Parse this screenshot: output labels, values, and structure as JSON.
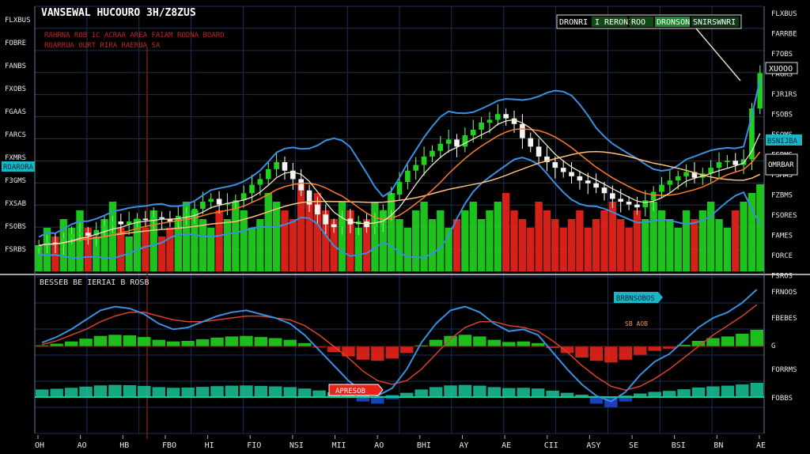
{
  "header": {
    "title": "VANSEWAL HUCOURO 3H/Z8ZUS",
    "subtitle_line1": "RAHRNA ROB 1C ACRAA AREA FAIAM RODNA BOARO",
    "subtitle_line2": "ROARRUA OURT RIRA RAERUA SA"
  },
  "legend_box": {
    "items": [
      "DRONRI",
      "I RERONI",
      "ROO",
      "DRONSON",
      "SNIRSWNRI"
    ]
  },
  "right_tags": {
    "price_tag": "XUOOO",
    "cyan_tag": "BSNIJBA",
    "white_tag": "OMRBAR"
  },
  "left_tag": "ROARORA",
  "y_ticks_main": [
    "FLXBUS",
    "FARRBE",
    "F7OBS",
    "FAGRS",
    "FJR1RS",
    "FSOBS",
    "FSOMS",
    "FSRMS",
    "FSMAS",
    "FZBMS",
    "FSORES",
    "FAMES",
    "FORCE",
    "FSROS"
  ],
  "y_ticks_left": [
    "FLXBUS",
    "FOBRE",
    "FANBS",
    "FXOBS",
    "FGAAS",
    "FARCS",
    "FXMRS",
    "F3GMS",
    "FXSAB",
    "FSOBS",
    "FSRBS"
  ],
  "osc_header": "BESSEB BE IERIAI B ROSB",
  "osc_tags": {
    "cyan": "BRBNSOBOS",
    "red": "APRESOB",
    "small": "SB AOB"
  },
  "y_ticks_osc": [
    "FRNOOS",
    "FBEBES",
    "G",
    "FORRMS",
    "FOBBS"
  ],
  "x_ticks": [
    "OH",
    "AO",
    "HB",
    "FBO",
    "HI",
    "FIO",
    "NSI",
    "MII",
    "AO",
    "BHI",
    "AY",
    "AE",
    "CII",
    "ASY",
    "SE",
    "BSI",
    "BN",
    "AE"
  ],
  "colors": {
    "up": "#1fd21f",
    "down": "#e8241a",
    "band": "#3a8fe0",
    "ma_fast": "#f0e6c8",
    "ma_slow": "#ff7a2a",
    "ma_mid": "#ffbf7a",
    "grid": "#1c2f5a",
    "teal": "#17c79a"
  },
  "chart_data": {
    "type": "line",
    "title": "VANSEWAL HUCOURO 3H/Z8ZUS",
    "price": {
      "close": [
        6.1,
        6.3,
        6.2,
        6.6,
        6.9,
        7.0,
        6.8,
        7.2,
        7.5,
        7.8,
        7.6,
        7.8,
        8.0,
        7.9,
        8.1,
        8.0,
        7.8,
        8.2,
        8.4,
        8.7,
        9.2,
        9.4,
        9.0,
        9.1,
        9.3,
        9.8,
        10.4,
        10.8,
        11.5,
        12.0,
        11.4,
        10.8,
        10.0,
        9.0,
        8.3,
        7.6,
        7.4,
        8.0,
        7.6,
        7.8,
        7.4,
        7.7,
        8.6,
        9.7,
        10.6,
        11.4,
        11.8,
        12.4,
        12.8,
        13.3,
        13.6,
        13.1,
        13.9,
        14.3,
        14.8,
        15.0,
        15.4,
        15.1,
        14.7,
        13.7,
        13.1,
        12.4,
        12.0,
        11.6,
        11.3,
        11.0,
        10.7,
        10.5,
        10.2,
        9.8,
        9.4,
        9.2,
        9.0,
        8.8,
        9.3,
        9.9,
        10.4,
        10.7,
        11.0,
        11.3,
        10.9,
        11.2,
        11.6,
        12.0,
        12.1,
        11.8,
        12.2,
        15.8,
        18.3
      ],
      "ylim": [
        5,
        19
      ]
    },
    "volume": {
      "values": [
        3,
        5,
        4,
        6,
        5,
        7,
        5,
        4,
        6,
        8,
        5,
        4,
        6,
        5,
        7,
        4,
        5,
        6,
        8,
        7,
        6,
        5,
        7,
        6,
        8,
        7,
        5,
        6,
        9,
        8,
        7,
        6,
        10,
        8,
        9,
        7,
        6,
        8,
        7,
        5,
        6,
        8,
        7,
        9,
        6,
        5,
        7,
        8,
        6,
        7,
        5,
        6,
        7,
        8,
        6,
        7,
        8,
        9,
        7,
        6,
        5,
        8,
        7,
        6,
        5,
        6,
        7,
        5,
        6,
        7,
        8,
        6,
        5,
        7,
        6,
        8,
        7,
        6,
        5,
        7,
        6,
        7,
        8,
        6,
        5,
        7,
        8,
        9,
        10
      ],
      "up": [
        1,
        1,
        0,
        1,
        1,
        1,
        0,
        1,
        1,
        1,
        0,
        1,
        1,
        0,
        1,
        0,
        0,
        1,
        1,
        1,
        1,
        1,
        0,
        1,
        1,
        1,
        1,
        1,
        1,
        1,
        0,
        0,
        0,
        0,
        0,
        0,
        0,
        1,
        0,
        1,
        0,
        1,
        1,
        1,
        1,
        1,
        1,
        1,
        1,
        1,
        1,
        0,
        1,
        1,
        1,
        1,
        1,
        0,
        0,
        0,
        0,
        0,
        0,
        0,
        0,
        0,
        0,
        0,
        0,
        0,
        0,
        0,
        0,
        0,
        1,
        1,
        1,
        1,
        1,
        1,
        0,
        1,
        1,
        1,
        1,
        0,
        1,
        1,
        1
      ]
    },
    "oscillator": {
      "macd": [
        0.2,
        0.5,
        0.9,
        1.4,
        1.9,
        2.1,
        2.0,
        1.7,
        1.2,
        0.9,
        1.0,
        1.3,
        1.6,
        1.8,
        1.9,
        1.7,
        1.5,
        1.2,
        0.6,
        -0.2,
        -1.0,
        -1.8,
        -2.4,
        -2.6,
        -2.2,
        -1.2,
        0.2,
        1.2,
        1.9,
        2.1,
        1.8,
        1.2,
        0.8,
        0.9,
        0.6,
        -0.3,
        -1.2,
        -2.0,
        -2.6,
        -2.9,
        -2.4,
        -1.5,
        -0.8,
        -0.4,
        0.3,
        1.0,
        1.5,
        1.8,
        2.3,
        3.0
      ],
      "signal": [
        0.1,
        0.3,
        0.6,
        0.9,
        1.3,
        1.6,
        1.8,
        1.8,
        1.6,
        1.4,
        1.3,
        1.3,
        1.4,
        1.5,
        1.6,
        1.6,
        1.5,
        1.4,
        1.1,
        0.6,
        0.0,
        -0.6,
        -1.3,
        -1.8,
        -2.0,
        -1.8,
        -1.2,
        -0.4,
        0.4,
        1.0,
        1.3,
        1.3,
        1.1,
        1.0,
        0.8,
        0.3,
        -0.3,
        -1.0,
        -1.6,
        -2.1,
        -2.3,
        -2.1,
        -1.7,
        -1.2,
        -0.6,
        0.0,
        0.6,
        1.1,
        1.6,
        2.2
      ],
      "ylim": [
        -4,
        4
      ]
    },
    "x_ticks": [
      "OH",
      "AO",
      "HB",
      "FBO",
      "HI",
      "FIO",
      "NSI",
      "MII",
      "AO",
      "BHI",
      "AY",
      "AE",
      "CII",
      "ASY",
      "SE",
      "BSI",
      "BN",
      "AE"
    ],
    "grid": true
  }
}
